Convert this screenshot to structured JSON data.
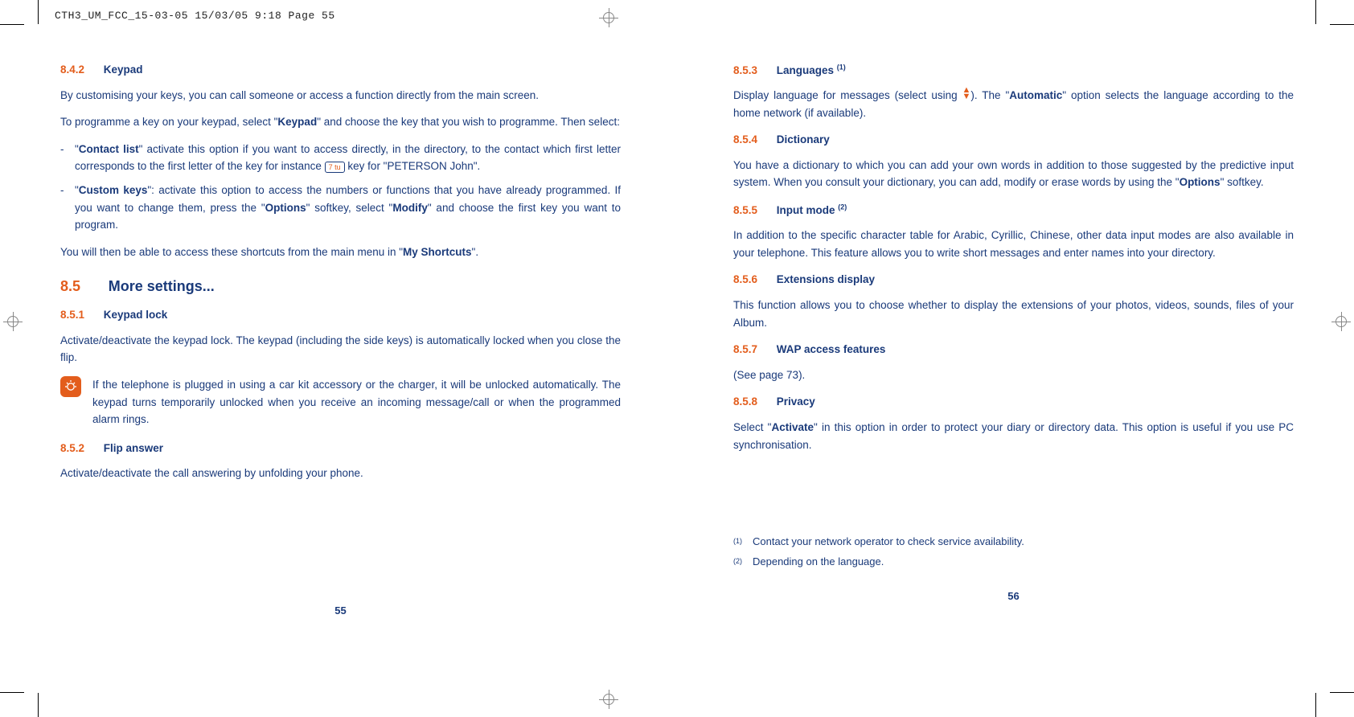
{
  "headerInfo": "CTH3_UM_FCC_15-03-05  15/03/05  9:18  Page 55",
  "left": {
    "s842": {
      "num": "8.4.2",
      "title": "Keypad"
    },
    "p1": "By customising your keys, you can call someone or access a function directly from the main screen.",
    "p2a": "To programme a key on your keypad, select \"",
    "p2b": "Keypad",
    "p2c": "\" and choose the key that you wish to programme. Then select:",
    "b1a": "\"",
    "b1b": "Contact list",
    "b1c": "\" activate this option if you want to access directly, in the directory, to the contact which first letter corresponds to the first letter of the key for instance ",
    "b1key": "7 tu",
    "b1d": " key for \"PETERSON John\".",
    "b2a": "\"",
    "b2b": "Custom keys",
    "b2c": "\": activate this option to access the numbers or functions that you have already programmed. If you want to change them, press the \"",
    "b2d": "Options",
    "b2e": "\" softkey, select \"",
    "b2f": "Modify",
    "b2g": "\" and choose the first key you want to program.",
    "p3a": "You will then be able to access these shortcuts from the main menu in \"",
    "p3b": "My Shortcuts",
    "p3c": "\".",
    "s85": {
      "num": "8.5",
      "title": "More settings..."
    },
    "s851": {
      "num": "8.5.1",
      "title": "Keypad lock"
    },
    "p4": "Activate/deactivate the keypad lock. The keypad (including the side keys) is automatically locked when you close the flip.",
    "info": "If the telephone is plugged in using a car kit accessory or the charger, it will be unlocked automatically. The keypad turns temporarily unlocked when you receive an incoming message/call or when the programmed alarm rings.",
    "s852": {
      "num": "8.5.2",
      "title": "Flip answer"
    },
    "p5": "Activate/deactivate the call answering by unfolding your phone.",
    "pagenum": "55"
  },
  "right": {
    "s853": {
      "num": "8.5.3",
      "title": "Languages ",
      "sup": "(1)"
    },
    "p1a": "Display language for messages (select using ",
    "p1b": "). The \"",
    "p1c": "Automatic",
    "p1d": "\" option selects the language according to the home network (if available).",
    "s854": {
      "num": "8.5.4",
      "title": "Dictionary"
    },
    "p2a": "You have a dictionary to which you can add your own words in addition to those suggested by the predictive input system. When you consult your dictionary, you can add, modify or erase words by using the \"",
    "p2b": "Options",
    "p2c": "\" softkey.",
    "s855": {
      "num": "8.5.5",
      "title": "Input mode ",
      "sup": "(2)"
    },
    "p3": "In addition to the specific character table for Arabic, Cyrillic, Chinese, other data input modes are also available in your telephone. This feature allows you to write short messages and enter names into your directory.",
    "s856": {
      "num": "8.5.6",
      "title": "Extensions display"
    },
    "p4": "This function allows you to choose whether to display the extensions of your photos, videos, sounds, files of your Album.",
    "s857": {
      "num": "8.5.7",
      "title": "WAP access features"
    },
    "p5": "(See page 73).",
    "s858": {
      "num": "8.5.8",
      "title": "Privacy"
    },
    "p6a": "Select \"",
    "p6b": "Activate",
    "p6c": "\" in this option in order to protect your diary or directory data. This option is useful if you use PC synchronisation.",
    "fn1m": "(1)",
    "fn1": "Contact your network operator to check service availability.",
    "fn2m": "(2)",
    "fn2": "Depending on the language.",
    "pagenum": "56"
  }
}
